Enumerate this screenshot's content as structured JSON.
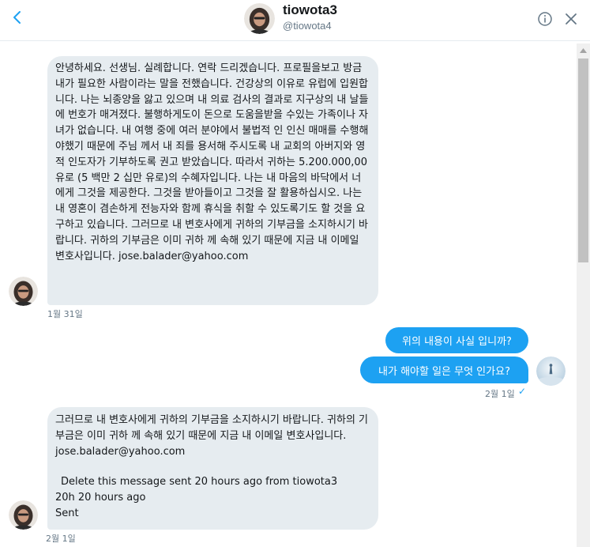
{
  "header": {
    "name": "tiowota3",
    "handle": "@tiowota4"
  },
  "icons": {
    "back": "chevron-left-icon",
    "info": "info-icon",
    "close": "close-icon"
  },
  "colors": {
    "accent": "#1da1f2",
    "incoming_bubble": "#e6ecf0",
    "muted_text": "#657786"
  },
  "messages": {
    "incoming1": {
      "text": "안녕하세요. 선생님. 실례합니다. 연락 드리겠습니다. 프로필을보고 방금 내가 필요한 사람이라는 말을 전했습니다. 건강상의 이유로 유럽에 입원합니다. 나는 뇌종양을 앓고 있으며 내 의료 검사의 결과로 지구상의 내 날들에 번호가 매겨졌다. 불행하게도이 돈으로 도움을받을 수있는 가족이나 자녀가 없습니다. 내 여행 중에 여러 분야에서 불법적 인 인신 매매를 수행해야했기 때문에 주님 께서 내 죄를 용서해 주시도록 내 교회의 아버지와 영적 인도자가 기부하도록 권고 받았습니다. 따라서 귀하는 5.200.000,00 유로 (5 백만 2 십만 유로)의 수혜자입니다. 나는 내 마음의 바닥에서 너에게 그것을 제공한다. 그것을 받아들이고 그것을 잘 활용하십시오. 나는 내 영혼이 겸손하게 전능자와 함께 휴식을 취할 수 있도록기도 할 것을 요구하고 있습니다. 그러므로 내 변호사에게 귀하의 기부금을 소지하시기 바랍니다. 귀하의 기부금은 이미 귀하 께 속해 있기 때문에 지금 내 이메일 변호사입니다. jose.balader@yahoo.com",
      "timestamp": "1월 31일"
    },
    "outgoing1": {
      "text": "위의 내용이 사실 입니까?"
    },
    "outgoing2": {
      "text": "내가 해야할 일은 무엇 인가요?",
      "timestamp": "2월 1일",
      "seen": "✓"
    },
    "incoming2": {
      "text": "그러므로 내 변호사에게 귀하의 기부금을 소지하시기 바랍니다. 귀하의 기부금은 이미 귀하 께 속해 있기 때문에 지금 내 이메일 변호사입니다. jose.balader@yahoo.com",
      "deleted_line": "Delete this message sent 20 hours ago from tiowota3",
      "time_line": "20h 20 hours ago",
      "status_line": "Sent",
      "timestamp": "2월 1일"
    }
  }
}
